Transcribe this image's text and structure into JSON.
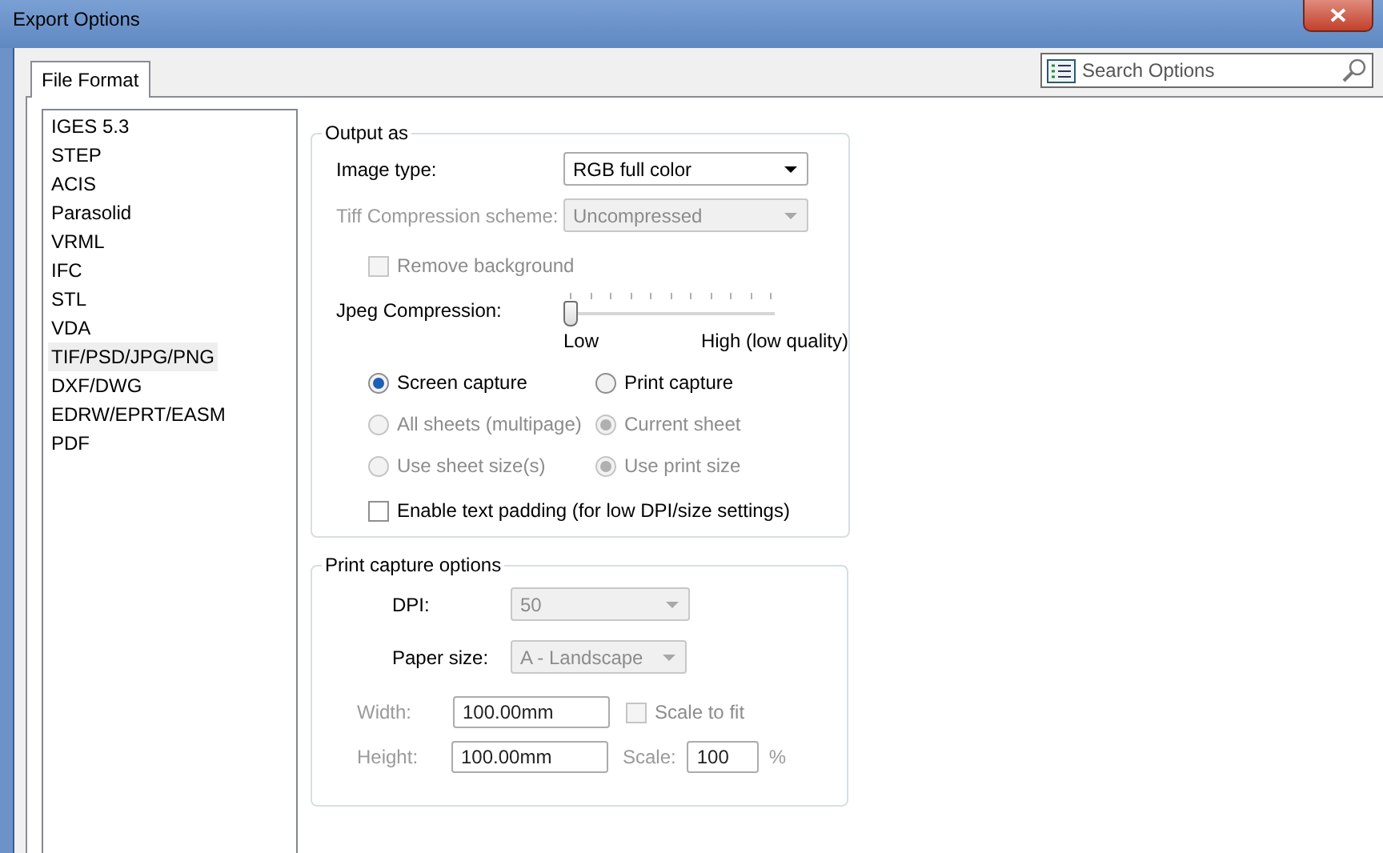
{
  "window": {
    "title": "Export Options"
  },
  "tabs": [
    {
      "label": "File Format",
      "selected": true
    }
  ],
  "search": {
    "placeholder": "Search Options"
  },
  "formats": [
    {
      "label": "IGES 5.3",
      "selected": false
    },
    {
      "label": "STEP",
      "selected": false
    },
    {
      "label": "ACIS",
      "selected": false
    },
    {
      "label": "Parasolid",
      "selected": false
    },
    {
      "label": "VRML",
      "selected": false
    },
    {
      "label": "IFC",
      "selected": false
    },
    {
      "label": "STL",
      "selected": false
    },
    {
      "label": "VDA",
      "selected": false
    },
    {
      "label": "TIF/PSD/JPG/PNG",
      "selected": true
    },
    {
      "label": "DXF/DWG",
      "selected": false
    },
    {
      "label": "EDRW/EPRT/EASM",
      "selected": false
    },
    {
      "label": "PDF",
      "selected": false
    }
  ],
  "output_as": {
    "title": "Output as",
    "image_type": {
      "label": "Image type:",
      "value": "RGB full color",
      "disabled": false
    },
    "tiff_compression": {
      "label": "Tiff Compression scheme:",
      "value": "Uncompressed",
      "disabled": true
    },
    "remove_background": {
      "label": "Remove background",
      "checked": false,
      "disabled": true
    },
    "jpeg_compression": {
      "label": "Jpeg Compression:",
      "level": 0,
      "low": "Low",
      "high": "High (low quality)"
    },
    "radios": [
      {
        "label": "Screen capture",
        "selected": true,
        "disabled": false
      },
      {
        "label": "Print capture",
        "selected": false,
        "disabled": false
      },
      {
        "label": "All sheets (multipage)",
        "selected": false,
        "disabled": true
      },
      {
        "label": "Current sheet",
        "selected": true,
        "disabled": true
      },
      {
        "label": "Use sheet size(s)",
        "selected": false,
        "disabled": true
      },
      {
        "label": "Use print size",
        "selected": true,
        "disabled": true
      }
    ],
    "text_padding": {
      "label": "Enable text padding (for low DPI/size settings)",
      "checked": false,
      "disabled": false
    }
  },
  "print_capture": {
    "title": "Print capture options",
    "dpi": {
      "label": "DPI:",
      "value": "50",
      "disabled": true
    },
    "paper_size": {
      "label": "Paper size:",
      "value": "A - Landscape",
      "disabled": true
    },
    "width": {
      "label": "Width:",
      "value": "100.00mm",
      "disabled": true
    },
    "scale_to_fit": {
      "label": "Scale to fit",
      "checked": false,
      "disabled": true
    },
    "height": {
      "label": "Height:",
      "value": "100.00mm",
      "disabled": true
    },
    "scale": {
      "label": "Scale:",
      "value": "100",
      "unit": "%",
      "disabled": true
    }
  }
}
